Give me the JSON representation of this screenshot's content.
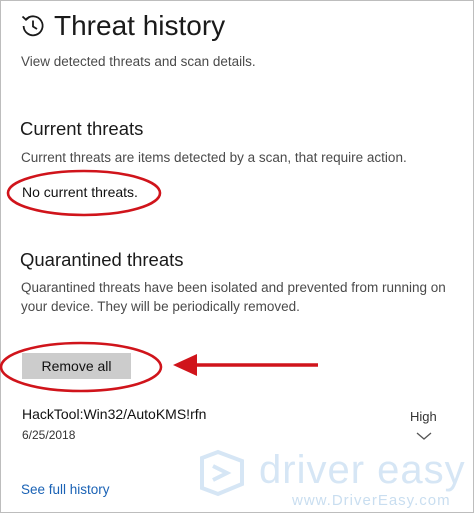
{
  "header": {
    "title": "Threat history",
    "description": "View detected threats and scan details."
  },
  "current_threats": {
    "heading": "Current threats",
    "description": "Current threats are items detected by a scan, that require action.",
    "status": "No current threats."
  },
  "quarantined_threats": {
    "heading": "Quarantined threats",
    "description_line1": "Quarantined threats have been isolated and prevented from running on",
    "description_line2": "your device.  They will be periodically removed.",
    "remove_button_label": "Remove all",
    "items": [
      {
        "name": "HackTool:Win32/AutoKMS!rfn",
        "date": "6/25/2018",
        "severity": "High"
      }
    ]
  },
  "footer": {
    "link_label": "See full history"
  },
  "watermark": {
    "brand": "driver easy",
    "url": "www.DriverEasy.com"
  },
  "colors": {
    "annotation_red": "#d0141b",
    "link_blue": "#1a62b5",
    "button_gray": "#cccccc"
  },
  "icons": {
    "title": "history-clock-icon",
    "expand": "chevron-down-icon",
    "watermark": "driver-easy-logo"
  }
}
